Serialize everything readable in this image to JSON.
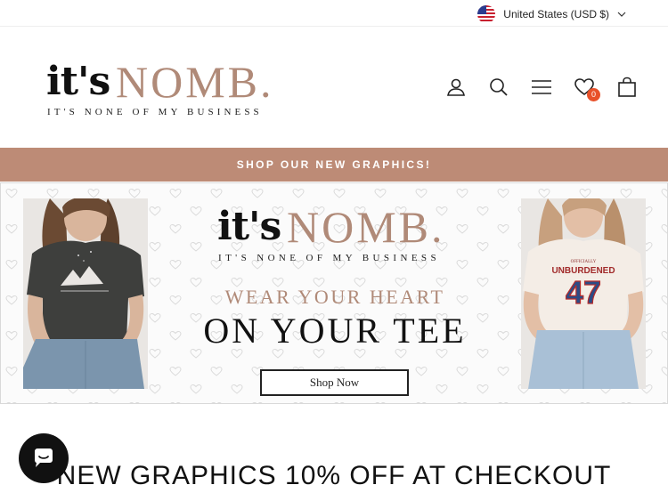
{
  "topbar": {
    "currency_label": "United States (USD $)",
    "flag_icon": "us-flag-icon",
    "chevron_icon": "chevron-down-icon"
  },
  "header": {
    "logo_its": "it's",
    "logo_nomb": "NOMB.",
    "logo_tagline": "IT'S NONE OF MY BUSINESS",
    "icons": [
      "user-icon",
      "search-icon",
      "menu-icon",
      "heart-icon",
      "bag-icon"
    ],
    "wishlist_count": "0"
  },
  "announcement": {
    "text": "SHOP OUR NEW GRAPHICS!"
  },
  "hero": {
    "logo_its": "it's",
    "logo_nomb": "NOMB.",
    "logo_tagline": "IT'S NONE OF MY BUSINESS",
    "tagline_1": "WEAR YOUR HEART",
    "tagline_2": "ON YOUR TEE",
    "cta_label": "Shop Now",
    "right_shirt_text": "UNBURDENED",
    "right_shirt_number": "47"
  },
  "promo": {
    "text": "NEW GRAPHICS 10% OFF AT CHECKOUT"
  },
  "colors": {
    "accent": "#bd8b76",
    "logo_brown": "#b08a78",
    "badge": "#e8512a"
  }
}
